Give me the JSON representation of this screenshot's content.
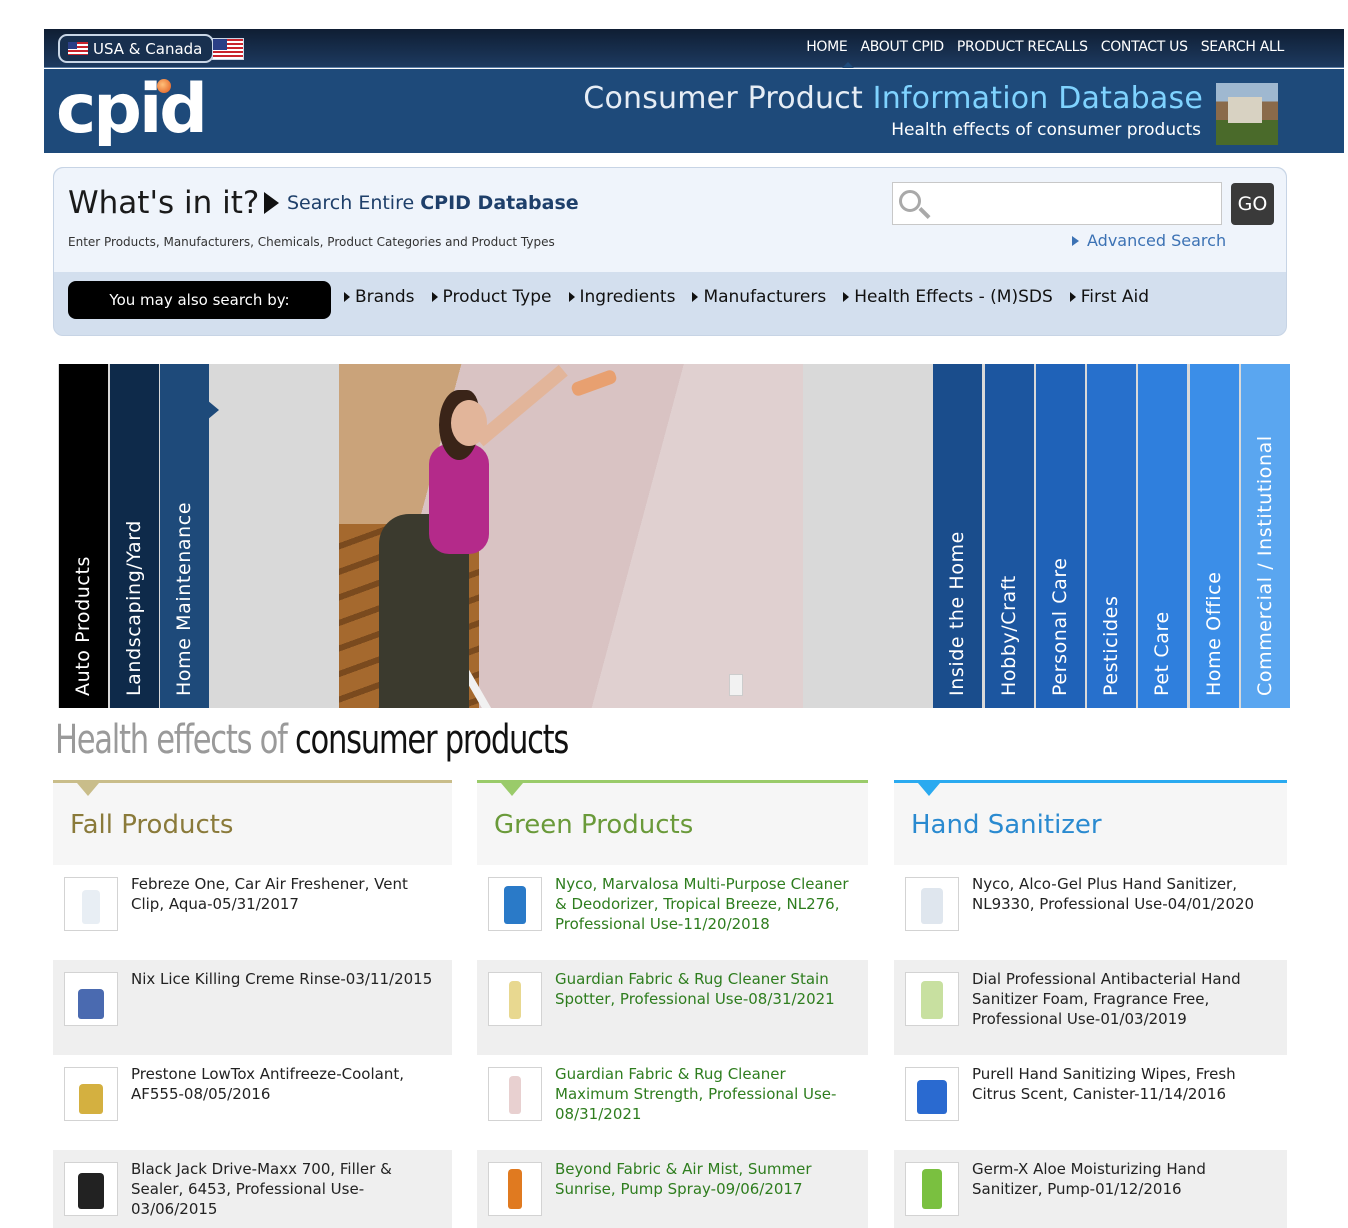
{
  "header": {
    "region_label": "USA & Canada",
    "nav": [
      "HOME",
      "ABOUT CPID",
      "PRODUCT RECALLS",
      "CONTACT US",
      "SEARCH ALL"
    ],
    "logo": "cpid",
    "title_part1": "Consumer Product ",
    "title_part2": "Information Database",
    "subtitle": "Health effects of consumer products"
  },
  "search": {
    "heading": "What's in it?",
    "entire_label_pre": "Search Entire ",
    "entire_label_bold": "CPID Database",
    "hint": "Enter Products, Manufacturers, Chemicals, Product Categories and Product Types",
    "input_value": "",
    "go_label": "GO",
    "advanced_label": "Advanced Search",
    "also_label": "You may also search by:",
    "also_items": [
      "Brands",
      "Product Type",
      "Ingredients",
      "Manufacturers",
      "Health Effects - (M)SDS",
      "First Aid"
    ]
  },
  "hero": {
    "left_tabs": [
      "Auto Products",
      "Landscaping/Yard",
      "Home Maintenance"
    ],
    "right_tabs": [
      "Inside the Home",
      "Hobby/Craft",
      "Personal Care",
      "Pesticides",
      "Pet Care",
      "Home Office",
      "Commercial / Institutional"
    ],
    "colors": {
      "left": [
        "#000000",
        "#0e2a4a",
        "#1e4a7a"
      ],
      "right": [
        "#1a4d8c",
        "#1c56a0",
        "#1f62b8",
        "#2770cc",
        "#2f7fdd",
        "#3b8ee8",
        "#5aa6f0"
      ]
    }
  },
  "headline": {
    "part1": "Health effects of ",
    "part2": "consumer products"
  },
  "columns": [
    {
      "title": "Fall Products",
      "color": "#8a7a3a",
      "rule_color": "#c9bd8a",
      "link_color": "#222222",
      "items": [
        "Febreze One, Car Air Freshener, Vent Clip, Aqua-05/31/2017",
        "Nix Lice Killing Creme Rinse-03/11/2015",
        "Prestone LowTox Antifreeze-Coolant, AF555-08/05/2016",
        "Black Jack Drive-Maxx 700, Filler & Sealer, 6453, Professional Use-03/06/2015"
      ]
    },
    {
      "title": "Green Products",
      "color": "#6a9a3a",
      "rule_color": "#9acb6a",
      "link_color": "#2e7d1e",
      "items": [
        "Nyco, Marvalosa Multi-Purpose Cleaner & Deodorizer, Tropical Breeze, NL276, Professional Use-11/20/2018",
        "Guardian Fabric & Rug Cleaner Stain Spotter, Professional Use-08/31/2021",
        "Guardian Fabric & Rug Cleaner Maximum Strength, Professional Use-08/31/2021",
        "Beyond Fabric & Air Mist, Summer Sunrise, Pump Spray-09/06/2017"
      ]
    },
    {
      "title": "Hand Sanitizer",
      "color": "#2a8ad0",
      "rule_color": "#2aaaf0",
      "link_color": "#222222",
      "items": [
        "Nyco, Alco-Gel Plus Hand Sanitizer, NL9330, Professional Use-04/01/2020",
        "Dial Professional Antibacterial Hand Sanitizer Foam, Fragrance Free, Professional Use-01/03/2019",
        "Purell Hand Sanitizing Wipes, Fresh Citrus Scent, Canister-11/14/2016",
        "Germ-X Aloe Moisturizing Hand Sanitizer, Pump-01/12/2016"
      ]
    }
  ]
}
